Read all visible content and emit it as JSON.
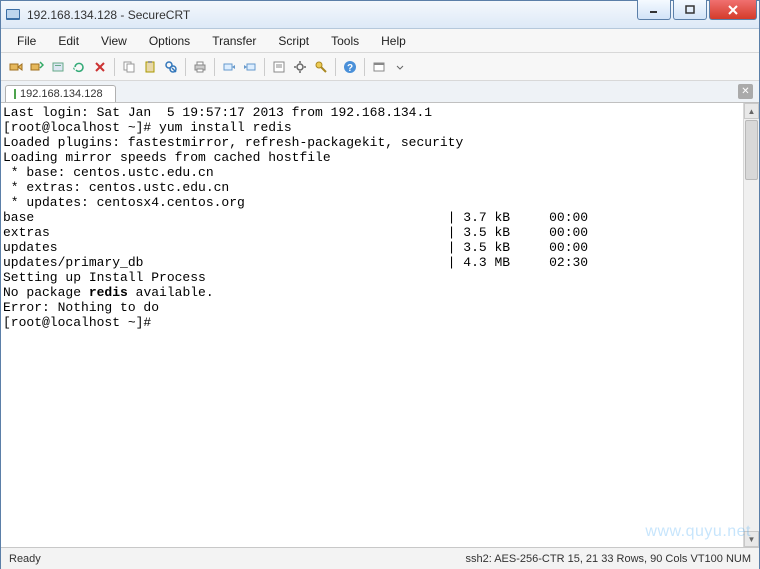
{
  "window": {
    "title": "192.168.134.128 - SecureCRT"
  },
  "menu": {
    "items": [
      "File",
      "Edit",
      "View",
      "Options",
      "Transfer",
      "Script",
      "Tools",
      "Help"
    ]
  },
  "tabs": {
    "active": "192.168.134.128"
  },
  "terminal": {
    "line1": "Last login: Sat Jan  5 19:57:17 2013 from 192.168.134.1",
    "line2a": "[root@localhost ~]# yum install redis",
    "line3": "Loaded plugins: fastestmirror, refresh-packagekit, security",
    "line4": "Loading mirror speeds from cached hostfile",
    "line5": " * base: centos.ustc.edu.cn",
    "line6": " * extras: centos.ustc.edu.cn",
    "line7": " * updates: centosx4.centos.org",
    "line8": "base                                                     | 3.7 kB     00:00",
    "line9": "extras                                                   | 3.5 kB     00:00",
    "line10": "updates                                                  | 3.5 kB     00:00",
    "line11": "updates/primary_db                                       | 4.3 MB     02:30",
    "line12": "Setting up Install Process",
    "line13a": "No package ",
    "line13b": "redis",
    "line13c": " available.",
    "line14": "Error: Nothing to do",
    "line15": "[root@localhost ~]#"
  },
  "status": {
    "left": "Ready",
    "right": "ssh2: AES-256-CTR   15,  21   33 Rows,  90 Cols   VT100         NUM"
  },
  "watermark": "www.quyu.net"
}
